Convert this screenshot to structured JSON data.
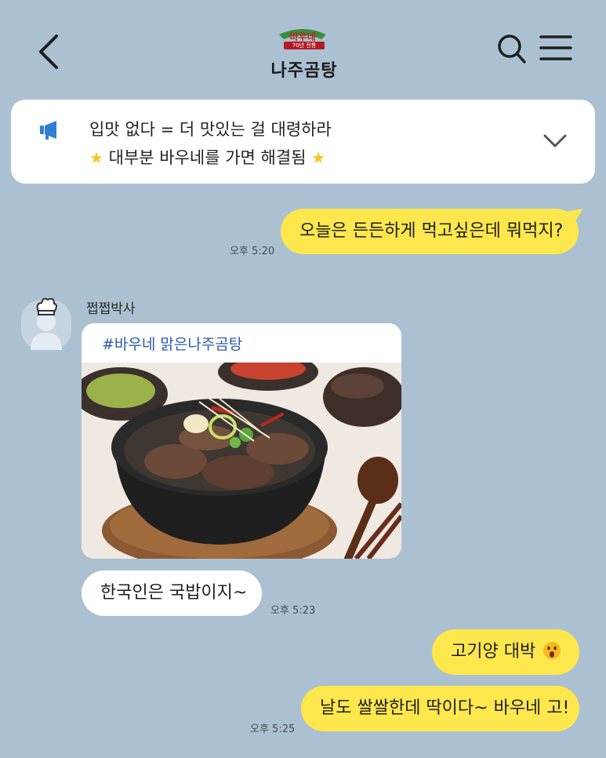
{
  "header": {
    "logo_brand": "바우네",
    "logo_badge": "70년 전통",
    "logo_name": "나주곰탕"
  },
  "notice": {
    "line1": "입맛 없다 = 더 맛있는 걸 대령하라",
    "line2": "대부분 바우네를 가면 해결됨"
  },
  "messages": {
    "m1": {
      "text": "오늘은 든든하게 먹고싶은데 뭐먹지?",
      "time": "오후 5:20"
    },
    "sender_name": "쩝쩝박사",
    "card_tag": "#바우네 맑은나주곰탕",
    "m2": {
      "text": "한국인은 국밥이지~",
      "time": "오후 5:23"
    },
    "m3": {
      "text": "고기양 대박"
    },
    "m4": {
      "text": "날도 쌀쌀한데 딱이다~ 바우네 고!",
      "time": "오후 5:25"
    }
  },
  "colors": {
    "background": "#abc1d1",
    "my_bubble": "#fde74c",
    "their_bubble": "#ffffff",
    "notice_icon": "#2f7fd6"
  }
}
